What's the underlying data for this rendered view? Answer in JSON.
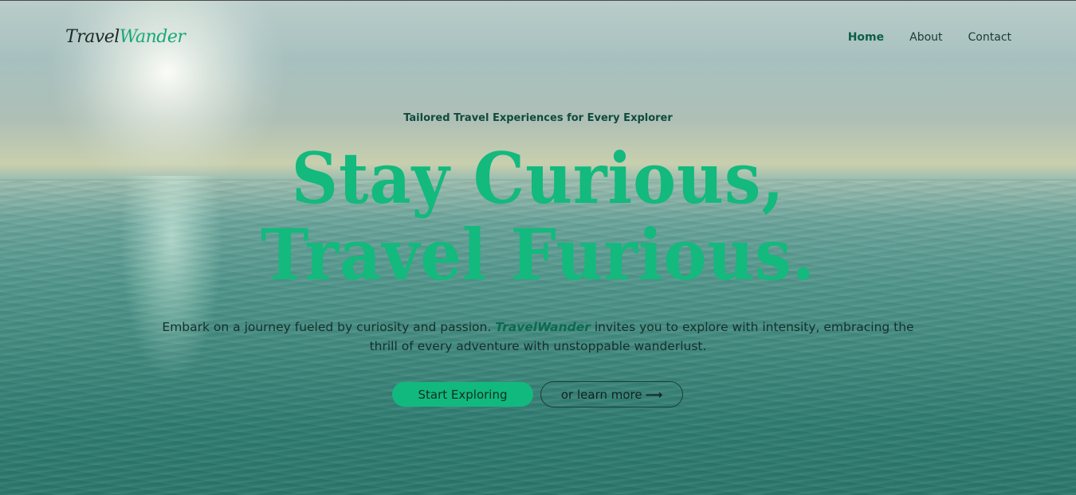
{
  "brand": {
    "logo_part1": "Travel",
    "logo_part2": "Wander"
  },
  "nav": {
    "items": [
      {
        "label": "Home",
        "active": true
      },
      {
        "label": "About",
        "active": false
      },
      {
        "label": "Contact",
        "active": false
      }
    ]
  },
  "hero": {
    "tagline": "Tailored Travel Experiences for Every Explorer",
    "headline_line1": "Stay Curious,",
    "headline_line2": "Travel Furious.",
    "description_before": "Embark on a journey fueled by curiosity and passion. ",
    "description_brand": "TravelWander",
    "description_after": " invites you to explore with intensity, embracing the thrill of every adventure with unstoppable wanderlust.",
    "primary_button": "Start Exploring",
    "secondary_button": "or learn more",
    "secondary_icon": "arrow-right-icon"
  },
  "colors": {
    "accent": "#13b97d",
    "nav_active": "#0d5e4a",
    "text_dark": "#14302b"
  }
}
